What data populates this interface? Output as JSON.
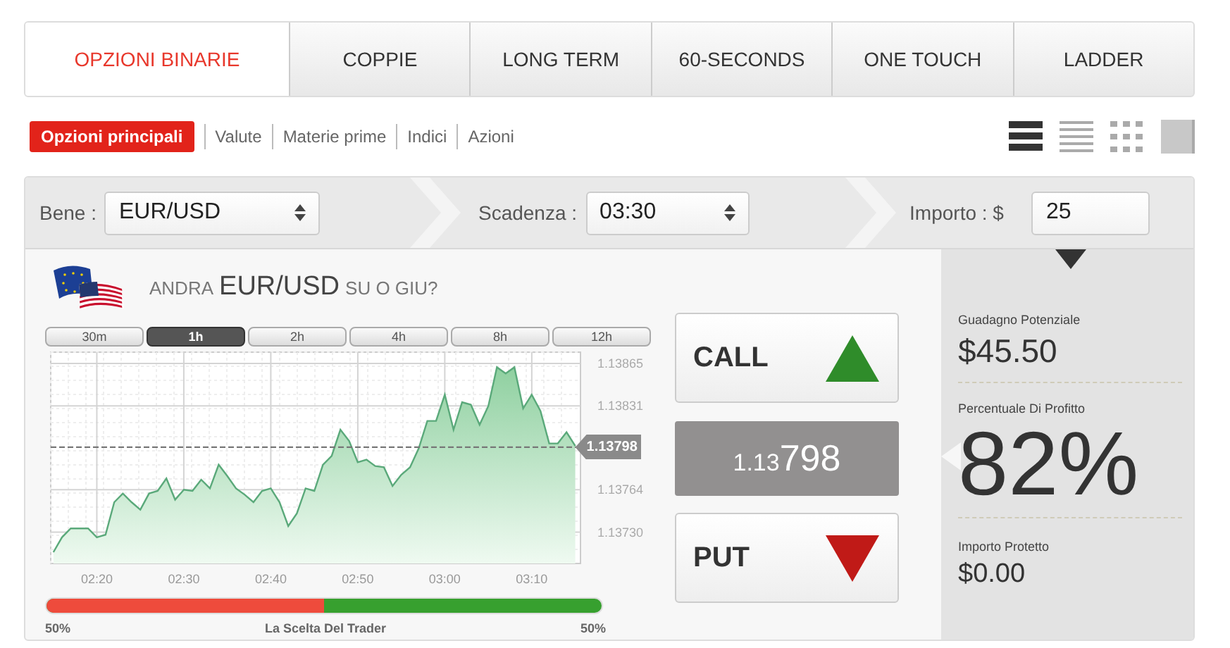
{
  "tabs": [
    {
      "label": "OPZIONI BINARIE",
      "selected": true
    },
    {
      "label": "COPPIE",
      "selected": false
    },
    {
      "label": "LONG TERM",
      "selected": false
    },
    {
      "label": "60-SECONDS",
      "selected": false
    },
    {
      "label": "ONE TOUCH",
      "selected": false
    },
    {
      "label": "LADDER",
      "selected": false
    }
  ],
  "categories": [
    {
      "label": "Opzioni principali",
      "selected": true
    },
    {
      "label": "Valute",
      "selected": false
    },
    {
      "label": "Materie prime",
      "selected": false
    },
    {
      "label": "Indici",
      "selected": false
    },
    {
      "label": "Azioni",
      "selected": false
    }
  ],
  "view_options": [
    {
      "kind": "list",
      "selected": true
    },
    {
      "kind": "lines",
      "selected": false
    },
    {
      "kind": "grid",
      "selected": false
    },
    {
      "kind": "tile",
      "selected": false
    }
  ],
  "trade_bar": {
    "asset_label": "Bene :",
    "asset_value": "EUR/USD",
    "expiry_label": "Scadenza :",
    "expiry_value": "03:30",
    "amount_label": "Importo : $",
    "amount_value": "25"
  },
  "question": {
    "prefix": "ANDRA",
    "asset": "EUR/USD",
    "suffix": "SU O GIU?"
  },
  "time_ranges": [
    {
      "label": "30m",
      "selected": false
    },
    {
      "label": "1h",
      "selected": true
    },
    {
      "label": "2h",
      "selected": false
    },
    {
      "label": "4h",
      "selected": false
    },
    {
      "label": "8h",
      "selected": false
    },
    {
      "label": "12h",
      "selected": false
    }
  ],
  "chart": {
    "price_tag": "1.13798",
    "chart_data": {
      "type": "area",
      "ylim": [
        1.13705,
        1.13874
      ],
      "grid": true,
      "ref_lines": [
        {
          "axis": "y",
          "value": 1.13798
        }
      ],
      "categories": [
        null,
        null,
        null,
        null,
        null,
        "02:20",
        null,
        null,
        null,
        null,
        null,
        null,
        null,
        null,
        null,
        "02:30",
        null,
        null,
        null,
        null,
        null,
        null,
        null,
        null,
        null,
        "02:40",
        null,
        null,
        null,
        null,
        null,
        null,
        null,
        null,
        null,
        "02:50",
        null,
        null,
        null,
        null,
        null,
        null,
        null,
        null,
        null,
        "03:00",
        null,
        null,
        null,
        null,
        null,
        null,
        null,
        null,
        null,
        "03:10",
        null,
        null,
        null,
        null,
        null
      ],
      "series": [
        {
          "color": "#5aa97a",
          "values": [
            1.13714,
            1.13726,
            1.13733,
            1.13733,
            1.13733,
            1.13726,
            1.13728,
            1.13754,
            1.13761,
            1.13754,
            1.13748,
            1.13761,
            1.13763,
            1.13773,
            1.13756,
            1.13764,
            1.13763,
            1.13772,
            1.13765,
            1.13784,
            1.13775,
            1.13765,
            1.1376,
            1.13754,
            1.13763,
            1.13765,
            1.13754,
            1.13735,
            1.13745,
            1.13765,
            1.13763,
            1.13784,
            1.13791,
            1.13812,
            1.13803,
            1.13786,
            1.13788,
            1.13783,
            1.13782,
            1.13767,
            1.13776,
            1.13782,
            1.13797,
            1.13819,
            1.13819,
            1.1384,
            1.13812,
            1.13834,
            1.13832,
            1.13816,
            1.13831,
            1.13862,
            1.13857,
            1.13862,
            1.13829,
            1.1384,
            1.13827,
            1.13801,
            1.13801,
            1.1381,
            1.13799
          ]
        }
      ],
      "yticks": [
        {
          "value": 1.1373,
          "label": "1.13730"
        },
        {
          "value": 1.13764,
          "label": "1.13764"
        },
        {
          "value": 1.13831,
          "label": "1.13831"
        },
        {
          "value": 1.13865,
          "label": "1.13865"
        }
      ]
    }
  },
  "trader_choice": {
    "put_share": "50%",
    "label": "La Scelta Del Trader",
    "call_share": "50%",
    "level": 0.5
  },
  "call_button": "CALL",
  "price": {
    "small": "1.13",
    "large": "798"
  },
  "put_button": "PUT",
  "summary": [
    {
      "label": "Guadagno Potenziale",
      "value": "$45.50",
      "kind": "medium"
    },
    {
      "label": "Percentuale Di Profitto",
      "value": "82%",
      "kind": "large"
    },
    {
      "label": "Importo Protetto",
      "value": "$0.00",
      "kind": "small"
    }
  ]
}
